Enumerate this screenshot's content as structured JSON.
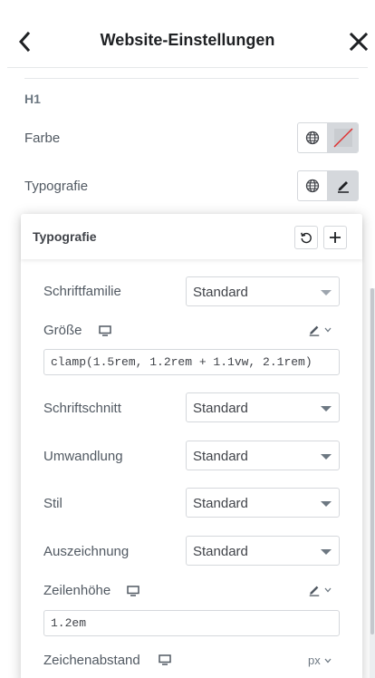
{
  "header": {
    "title": "Website-Einstellungen",
    "back_icon": "chevron-left-icon",
    "close_icon": "close-icon"
  },
  "section": {
    "title": "H1",
    "rows": [
      {
        "label": "Farbe",
        "controls": [
          "globe-icon",
          "no-color-swatch-icon"
        ]
      },
      {
        "label": "Typografie",
        "controls": [
          "globe-icon",
          "pencil-icon"
        ]
      }
    ]
  },
  "popover": {
    "title": "Typografie",
    "reset_icon": "reset-icon",
    "add_icon": "plus-icon",
    "fields": {
      "schriftfamilie": {
        "label": "Schriftfamilie",
        "value": "Standard"
      },
      "groesse": {
        "label": "Größe",
        "value": "clamp(1.5rem, 1.2rem + 1.1vw, 2.1rem)",
        "unit_icon": "pencil-icon"
      },
      "schriftschnitt": {
        "label": "Schriftschnitt",
        "value": "Standard"
      },
      "umwandlung": {
        "label": "Umwandlung",
        "value": "Standard"
      },
      "stil": {
        "label": "Stil",
        "value": "Standard"
      },
      "auszeichnung": {
        "label": "Auszeichnung",
        "value": "Standard"
      },
      "zeilenhoehe": {
        "label": "Zeilenhöhe",
        "value": "1.2em",
        "unit_icon": "pencil-icon"
      },
      "zeichenabstand": {
        "label": "Zeichenabstand",
        "unit": "px"
      }
    }
  },
  "colors": {
    "accent_red": "#e03131",
    "border": "#d5d8dc",
    "text": "#515962"
  }
}
